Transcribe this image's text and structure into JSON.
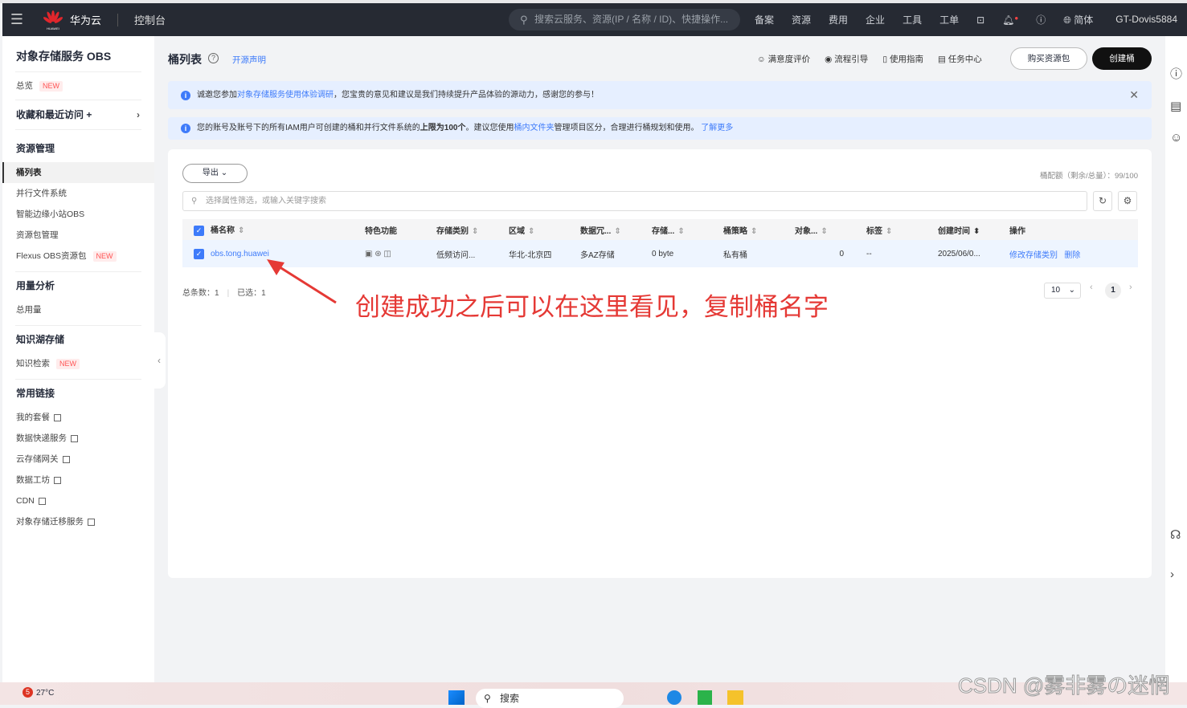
{
  "topbar": {
    "brand": "华为云",
    "console": "控制台",
    "search_placeholder": "搜索云服务、资源(IP / 名称 / ID)、快捷操作...",
    "nav": [
      "备案",
      "资源",
      "费用",
      "企业",
      "工具",
      "工单"
    ],
    "lang": "简体",
    "user": "GT-Dovis5884",
    "logo_text": "HUAWEI"
  },
  "sidebar": {
    "title": "对象存储服务 OBS",
    "overview": "总览",
    "new": "NEW",
    "favorites": "收藏和最近访问 +",
    "sections": [
      {
        "title": "资源管理",
        "items": [
          "桶列表",
          "并行文件系统",
          "智能边缘小站OBS",
          "资源包管理",
          "Flexus OBS资源包"
        ]
      },
      {
        "title": "用量分析",
        "items": [
          "总用量"
        ]
      },
      {
        "title": "知识湖存储",
        "items": [
          "知识检索"
        ]
      },
      {
        "title": "常用链接",
        "items": [
          "我的套餐",
          "数据快递服务",
          "云存储网关",
          "数据工坊",
          "CDN",
          "对象存储迁移服务"
        ]
      }
    ]
  },
  "page": {
    "title": "桶列表",
    "oss_link": "开源声明",
    "tools": [
      "满意度评价",
      "流程引导",
      "使用指南",
      "任务中心"
    ],
    "buy": "购买资源包",
    "create": "创建桶"
  },
  "alerts": {
    "a1_pre": "诚邀您参加",
    "a1_link": "对象存储服务使用体验调研",
    "a1_post": "，您宝贵的意见和建议是我们持续提升产品体验的源动力，感谢您的参与！",
    "a2_pre": "您的账号及账号下的所有IAM用户可创建的桶和并行文件系统的",
    "a2_bold": "上限为100个",
    "a2_mid": "。建议您使用",
    "a2_link": "桶内文件夹",
    "a2_post": "管理项目区分，合理进行桶规划和使用。",
    "a2_more": "了解更多"
  },
  "list": {
    "export": "导出",
    "quota_label": "桶配额（剩余/总量）：",
    "quota_value": "99/100",
    "filter_placeholder": "选择属性筛选，或输入关键字搜索",
    "columns": [
      "桶名称",
      "特色功能",
      "存储类别",
      "区域",
      "数据冗...",
      "存储...",
      "桶策略",
      "对象...",
      "标签",
      "创建时间",
      "操作"
    ],
    "rows": [
      {
        "name": "obs.tong.huawei",
        "storage_class": "低频访问...",
        "region": "华北-北京四",
        "redundancy": "多AZ存储",
        "used": "0 byte",
        "policy": "私有桶",
        "objects": "0",
        "tags": "--",
        "created": "2025/06/0...",
        "action1": "修改存储类别",
        "action2": "删除"
      }
    ],
    "total_label": "总条数：",
    "total": "1",
    "selected_label": "已选：",
    "selected": "1",
    "page_size": "10",
    "page": "1"
  },
  "annotation": "创建成功之后可以在这里看见，复制桶名字",
  "taskbar": {
    "temp": "27°C",
    "search": "搜索",
    "badge": "5"
  },
  "watermark": "CSDN @雾非雾の迷惘"
}
